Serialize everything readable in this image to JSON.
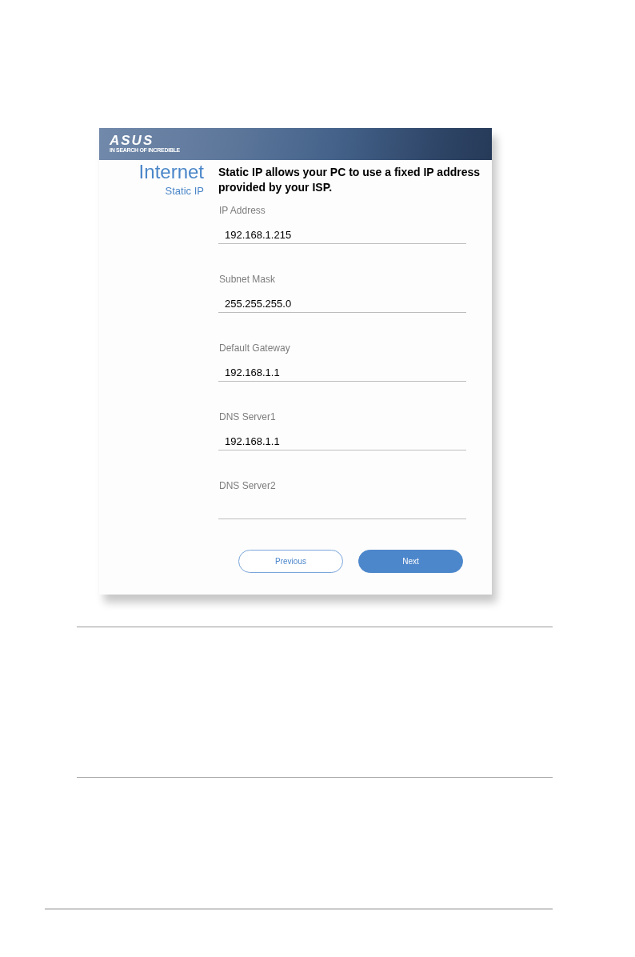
{
  "banner": {
    "logo": "ASUS",
    "tagline": "IN SEARCH OF INCREDIBLE"
  },
  "sidebar": {
    "title": "Internet",
    "subtitle": "Static IP"
  },
  "description": "Static IP allows your PC to use a fixed IP address provided by your ISP.",
  "fields": [
    {
      "label": "IP Address",
      "value": "192.168.1.215"
    },
    {
      "label": "Subnet Mask",
      "value": "255.255.255.0"
    },
    {
      "label": "Default Gateway",
      "value": "192.168.1.1"
    },
    {
      "label": "DNS Server1",
      "value": "192.168.1.1"
    },
    {
      "label": "DNS Server2"
    }
  ],
  "buttons": [
    {
      "label": "Previous",
      "kind": "secondary"
    },
    {
      "label": "Next",
      "kind": "primary"
    }
  ]
}
